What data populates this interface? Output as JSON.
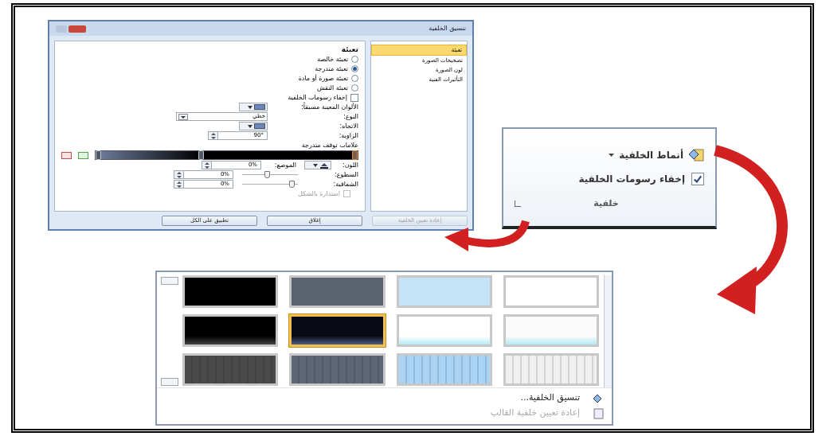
{
  "dialog": {
    "title": "تنسيق الخلفية",
    "sidebar": [
      {
        "label": "تعبئة",
        "selected": true
      },
      {
        "label": "تصحيحات الصورة",
        "selected": false
      },
      {
        "label": "لون الصورة",
        "selected": false
      },
      {
        "label": "التأثيرات الفنية",
        "selected": false
      }
    ],
    "fill": {
      "heading": "تعبئة",
      "options": [
        {
          "label": "تعبئة خالصة",
          "selected": false
        },
        {
          "label": "تعبئة متدرجة",
          "selected": true
        },
        {
          "label": "تعبئة صورة أو مادة",
          "selected": false
        },
        {
          "label": "تعبئة النقش",
          "selected": false
        }
      ],
      "hide_graphics": {
        "label": "إخفاء رسومات الخلفية",
        "checked": false
      },
      "preset_colors": {
        "label": "الألوان المعينة مسبقاً:"
      },
      "type": {
        "label": "النوع:",
        "value": "خطي"
      },
      "direction": {
        "label": "الاتجاه:"
      },
      "angle": {
        "label": "الزاوية:",
        "value": "90°"
      },
      "gradient_stops": {
        "label": "علامات توقف متدرجة",
        "stops": [
          {
            "level": 0,
            "selected": false
          },
          {
            "level": 0.4,
            "selected": false
          },
          {
            "level": 1,
            "selected": true
          }
        ]
      },
      "color": {
        "label": "اللون:"
      },
      "position": {
        "label": "الموضع:",
        "value": "0%"
      },
      "brightness": {
        "label": "السطوع:",
        "level": 0.45,
        "value": "0%"
      },
      "transparency": {
        "label": "الشفافية:",
        "level": 0.9,
        "value": "0%"
      },
      "rotate_with_shape": {
        "label": "استدارة بالشكل",
        "checked": false,
        "disabled": true
      }
    },
    "buttons": [
      {
        "label": "إعادة تعيين الخلفية",
        "disabled": true
      },
      {
        "label": "إغلاق",
        "disabled": false
      },
      {
        "label": "تطبيق على الكل",
        "disabled": false
      }
    ]
  },
  "ribbon_group": {
    "styles_button": "أنماط الخلفية",
    "hide_graphics": {
      "label": "إخفاء رسومات الخلفية",
      "checked": true
    },
    "group_label": "خلفية"
  },
  "gallery": {
    "swatches": [
      {
        "kind": "solid",
        "color": "#000000",
        "selected": false
      },
      {
        "kind": "solid",
        "color": "#5c6370",
        "selected": false
      },
      {
        "kind": "solid",
        "color": "#c5e3f7",
        "selected": false
      },
      {
        "kind": "solid",
        "color": "#ffffff",
        "selected": false
      },
      {
        "kind": "gradient",
        "color": "#000000",
        "selected": false
      },
      {
        "kind": "gradient",
        "color": "#0a0a14",
        "selected": true
      },
      {
        "kind": "gradient",
        "color": "#ffffff",
        "selected": false
      },
      {
        "kind": "gradient",
        "color": "#fafafa",
        "selected": false
      },
      {
        "kind": "stripes",
        "color": "#4a4a4a",
        "selected": false
      },
      {
        "kind": "stripes",
        "color": "#5c6675",
        "selected": false
      },
      {
        "kind": "stripes",
        "color": "#a9d3f5",
        "selected": false
      },
      {
        "kind": "stripes",
        "color": "#f0f0f0",
        "selected": false
      }
    ],
    "menu": [
      {
        "label": "تنسيق الخلفية...",
        "disabled": false
      },
      {
        "label": "إعادة تعيين خلفية القالب",
        "disabled": true
      }
    ]
  }
}
